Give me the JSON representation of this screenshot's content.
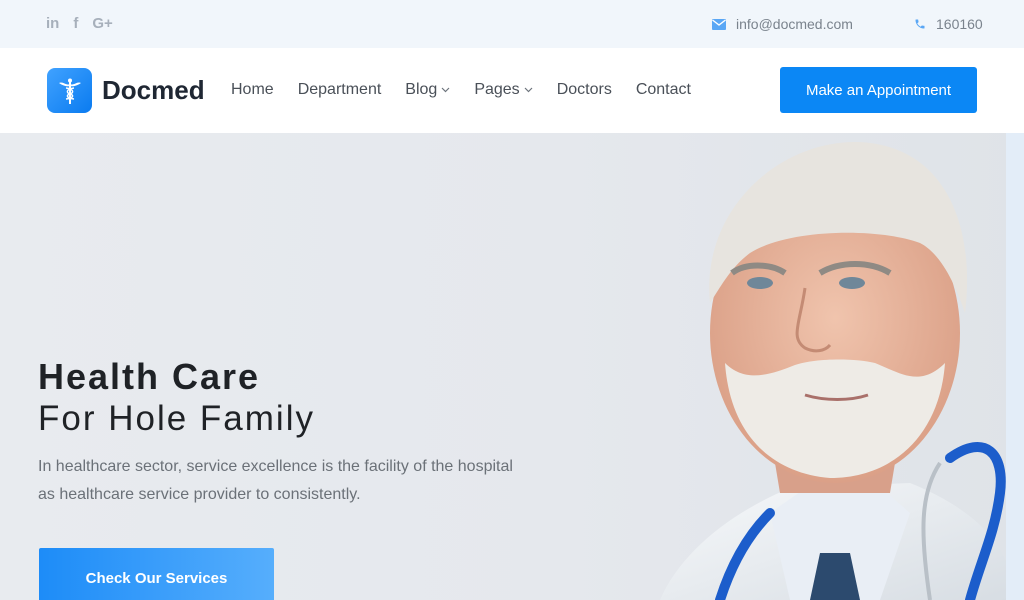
{
  "topbar": {
    "social": [
      {
        "icon": "linkedin-icon",
        "glyph": "in"
      },
      {
        "icon": "facebook-icon",
        "glyph": "f"
      },
      {
        "icon": "google-plus-icon",
        "glyph": "G+"
      }
    ],
    "email": "info@docmed.com",
    "phone": "160160"
  },
  "header": {
    "logo_text": "Docmed",
    "nav": {
      "home": "Home",
      "department": "Department",
      "blog": "Blog",
      "pages": "Pages",
      "doctors": "Doctors",
      "contact": "Contact"
    },
    "cta": "Make an Appointment"
  },
  "hero": {
    "title_line1": "Health Care",
    "title_line2": "For Hole Family",
    "description": "In healthcare sector, service excellence is the facility of the hospital as healthcare service provider to consistently.",
    "cta": "Check Our Services"
  },
  "colors": {
    "accent": "#0b87f5",
    "topbar_bg": "#f1f6fb",
    "hero_bg": "#e6e9ed"
  }
}
